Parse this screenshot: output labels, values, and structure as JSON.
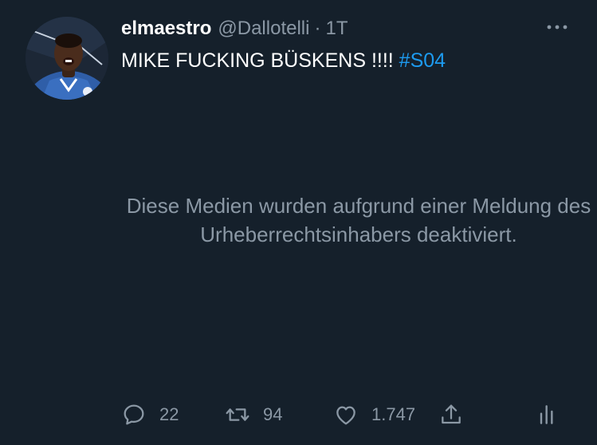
{
  "tweet": {
    "display_name": "elmaestro",
    "handle": "@Dallotelli",
    "separator": "·",
    "time": "1T",
    "text": "MIKE FUCKING BÜSKENS !!!! ",
    "hashtag": "#S04",
    "avatar_icon": "avatar-photo"
  },
  "media": {
    "message": "Diese Medien wurden aufgrund einer Meldung des Urheberrechtsinhabers deaktiviert."
  },
  "actions": {
    "reply_count": "22",
    "retweet_count": "94",
    "like_count": "1.747",
    "share_icon": "share-icon",
    "analytics_icon": "analytics-icon"
  },
  "colors": {
    "background": "#15202b",
    "text_primary": "#ffffff",
    "text_secondary": "#8b98a5",
    "link": "#1d9bf0"
  }
}
